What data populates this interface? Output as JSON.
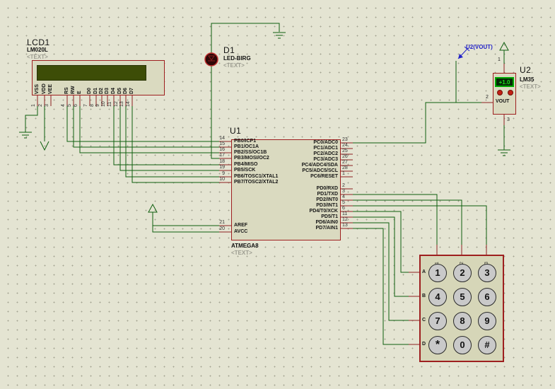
{
  "canvas": {
    "bg_color": "#E4E4D2",
    "dot_color": "#A4A492",
    "wire_color": "#0E5E0E",
    "pin_stub_color": "#8B2020",
    "component_border_color": "#9E1F1F",
    "component_fill_color": "#DADAC0",
    "lcd_screen_color": "#3D4D07",
    "probe_color": "#2121C8"
  },
  "lcd": {
    "ref": "LCD1",
    "part": "LM020L",
    "prop": "<TEXT>",
    "pins": [
      {
        "num": "1",
        "name": "VSS"
      },
      {
        "num": "2",
        "name": "VDD"
      },
      {
        "num": "3",
        "name": "VEE"
      },
      {
        "num": "4",
        "name": "RS"
      },
      {
        "num": "5",
        "name": "RW"
      },
      {
        "num": "6",
        "name": "E"
      },
      {
        "num": "7",
        "name": "D0"
      },
      {
        "num": "8",
        "name": "D1"
      },
      {
        "num": "9",
        "name": "D2"
      },
      {
        "num": "10",
        "name": "D3"
      },
      {
        "num": "11",
        "name": "D4"
      },
      {
        "num": "12",
        "name": "D5"
      },
      {
        "num": "13",
        "name": "D6"
      },
      {
        "num": "14",
        "name": "D7"
      }
    ]
  },
  "led": {
    "ref": "D1",
    "part": "LED-BIRG",
    "prop": "<TEXT>"
  },
  "mcu": {
    "ref": "U1",
    "part": "ATMEGA8",
    "prop": "<TEXT>",
    "left_pins": [
      {
        "num": "14",
        "name": "PB0/ICP1"
      },
      {
        "num": "15",
        "name": "PB1/OC1A"
      },
      {
        "num": "16",
        "name": "PB2/SS/OC1B"
      },
      {
        "num": "17",
        "name": "PB3/MOSI/OC2"
      },
      {
        "num": "18",
        "name": "PB4/MISO"
      },
      {
        "num": "19",
        "name": "PB5/SCK"
      },
      {
        "num": "9",
        "name": "PB6/TOSC1/XTAL1"
      },
      {
        "num": "10",
        "name": "PB7/TOSC2/XTAL2"
      },
      {
        "num": "21",
        "name": "AREF"
      },
      {
        "num": "20",
        "name": "AVCC"
      }
    ],
    "right_pins": [
      {
        "num": "23",
        "name": "PC0/ADC0"
      },
      {
        "num": "24",
        "name": "PC1/ADC1"
      },
      {
        "num": "25",
        "name": "PC2/ADC2"
      },
      {
        "num": "26",
        "name": "PC3/ADC3"
      },
      {
        "num": "27",
        "name": "PC4/ADC4/SDA"
      },
      {
        "num": "28",
        "name": "PC5/ADC5/SCL"
      },
      {
        "num": "1",
        "name": "PC6/RESET"
      },
      {
        "num": "2",
        "name": "PD0/RXD"
      },
      {
        "num": "3",
        "name": "PD1/TXD"
      },
      {
        "num": "4",
        "name": "PD2/INT0"
      },
      {
        "num": "5",
        "name": "PD3/INT1"
      },
      {
        "num": "6",
        "name": "PD4/T0/XCK"
      },
      {
        "num": "11",
        "name": "PD5/T1"
      },
      {
        "num": "12",
        "name": "PD6/AIN0"
      },
      {
        "num": "13",
        "name": "PD7/AIN1"
      }
    ]
  },
  "sensor": {
    "ref": "U2",
    "part": "LM35",
    "prop": "<TEXT>",
    "display": "+1.0",
    "vout": "VOUT",
    "pin_top": "1",
    "pin_left": "2",
    "pin_bottom": "3"
  },
  "probe": {
    "label": "U2(VOUT)"
  },
  "keypad": {
    "rows": [
      "A",
      "B",
      "C",
      "D"
    ],
    "cols": [
      "1",
      "2",
      "3"
    ],
    "keys": [
      "1",
      "2",
      "3",
      "4",
      "5",
      "6",
      "7",
      "8",
      "9",
      "*",
      "0",
      "#"
    ]
  }
}
